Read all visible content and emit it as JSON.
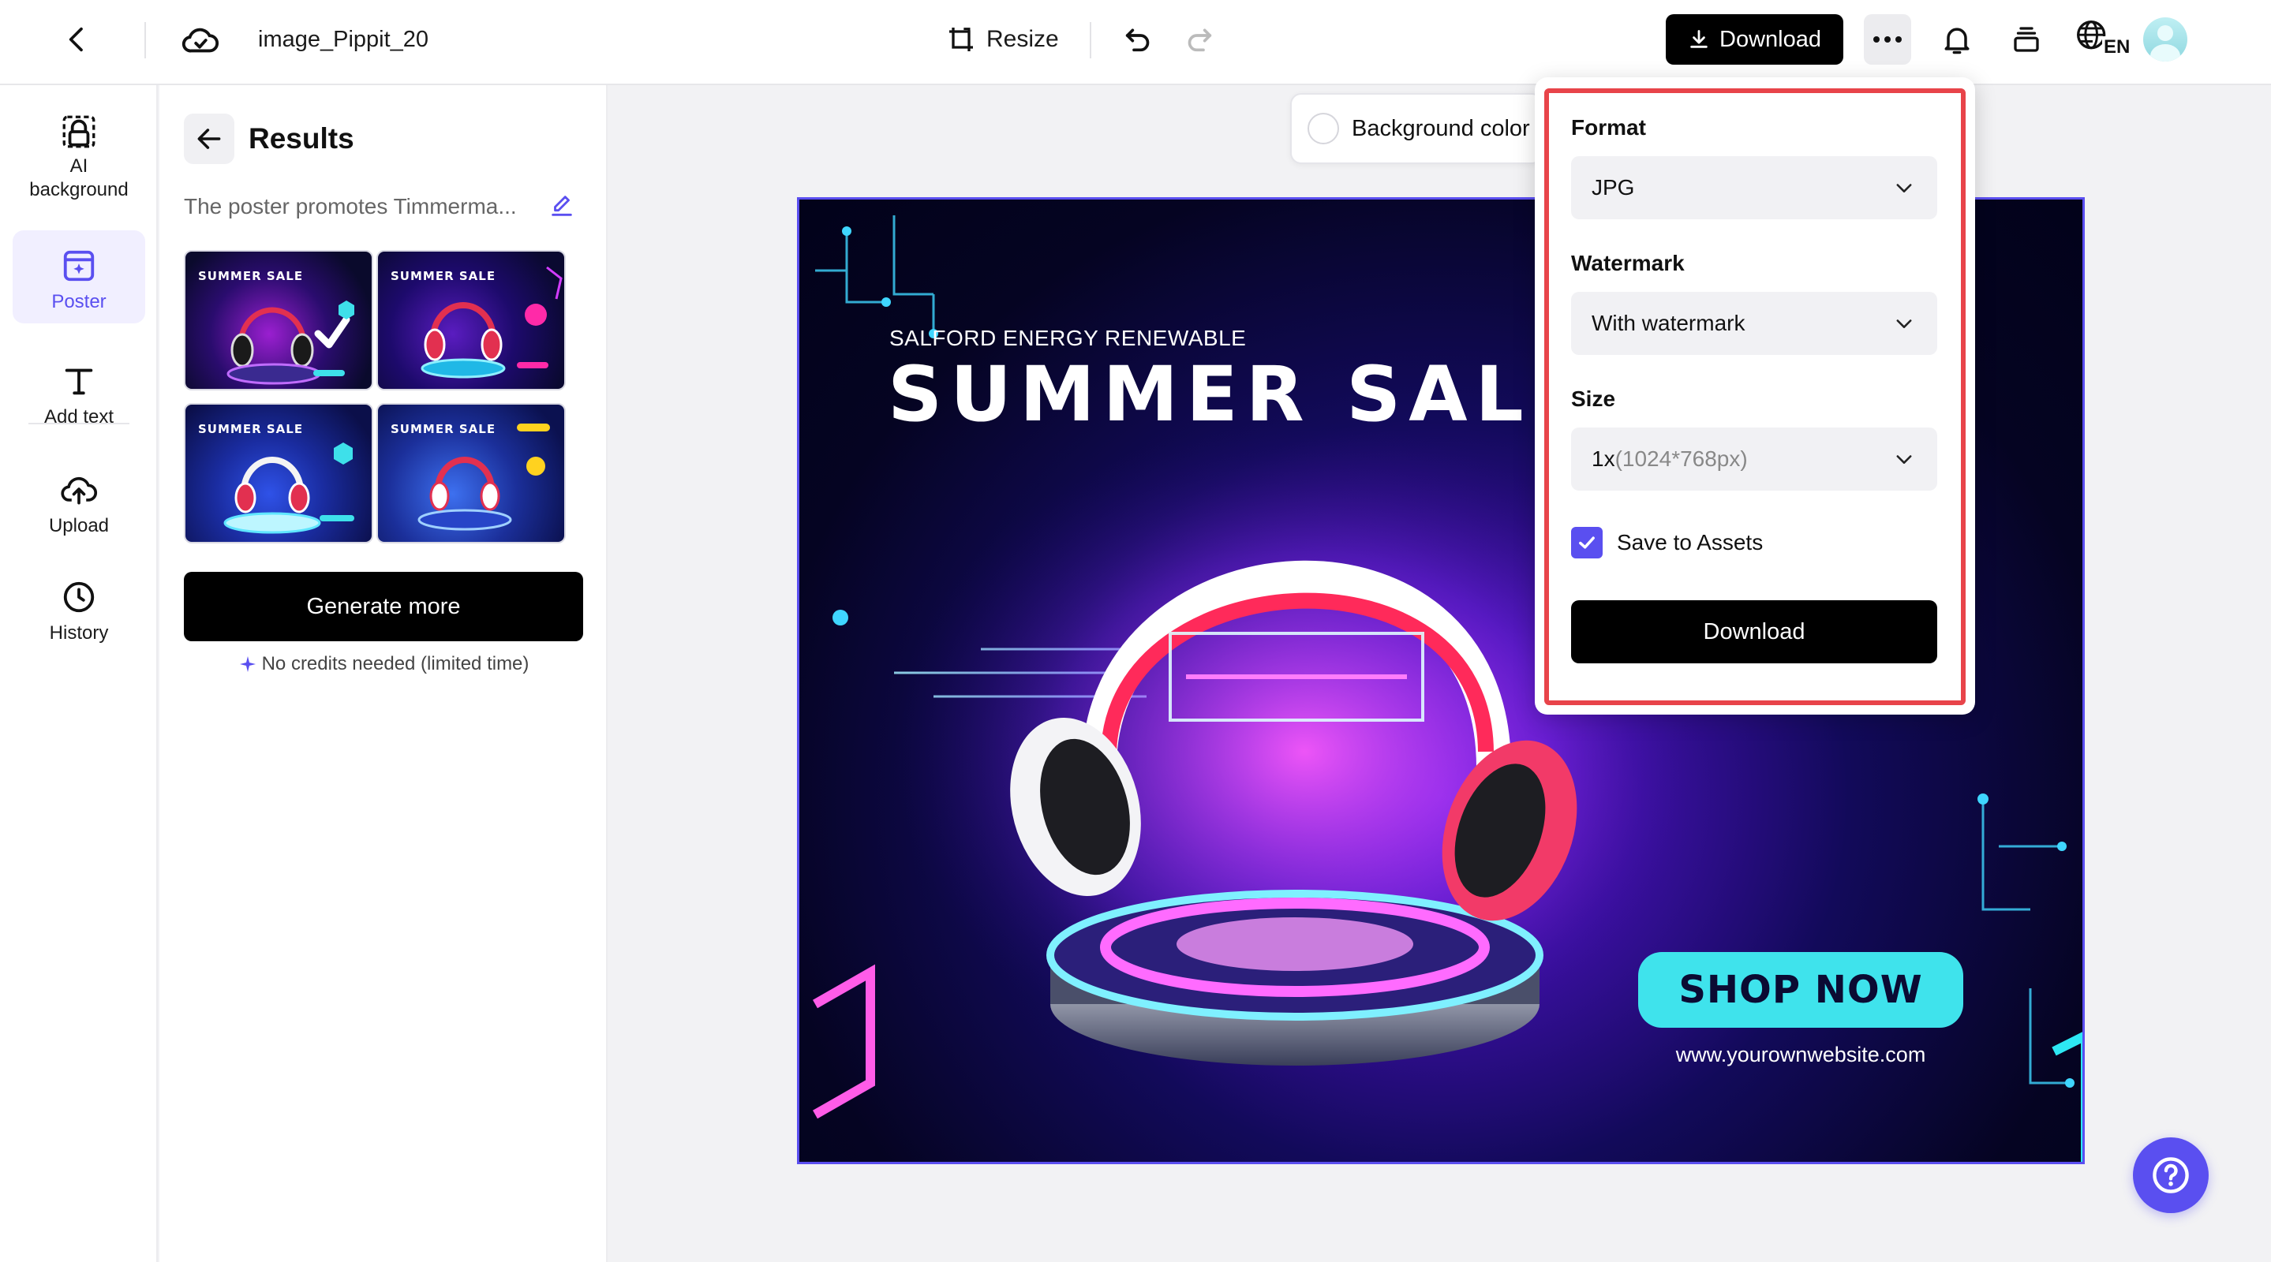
{
  "header": {
    "filename": "image_Pippit_20",
    "resize_label": "Resize",
    "download_label": "Download",
    "language_badge": "EN"
  },
  "sidebar": {
    "items": [
      {
        "label": "AI\nbackground",
        "icon": "ai-background-icon"
      },
      {
        "label": "Poster",
        "icon": "poster-icon"
      },
      {
        "label": "Add text",
        "icon": "text-icon"
      },
      {
        "label": "Upload",
        "icon": "upload-icon"
      },
      {
        "label": "History",
        "icon": "history-icon"
      }
    ],
    "active_item": "Poster"
  },
  "results_panel": {
    "title": "Results",
    "prompt": "The poster promotes Timmerma...",
    "thumbnails": [
      {
        "title": "SUMMER SALE"
      },
      {
        "title": "SUMMER SALE"
      },
      {
        "title": "SUMMER SALE"
      },
      {
        "title": "SUMMER SALE"
      }
    ],
    "generate_more_label": "Generate more",
    "credits_note": "No credits needed (limited time)"
  },
  "canvas": {
    "background_color_label": "Background color",
    "poster": {
      "subtitle": "SALFORD ENERGY RENEWABLE",
      "title": "SUMMER SALE",
      "cta": "SHOP NOW",
      "website": "www.yourownwebsite.com"
    }
  },
  "download_popover": {
    "format_label": "Format",
    "format_value": "JPG",
    "watermark_label": "Watermark",
    "watermark_value": "With watermark",
    "size_label": "Size",
    "size_value": "1x",
    "size_detail": "(1024*768px)",
    "save_to_assets_label": "Save to Assets",
    "save_to_assets_checked": true,
    "download_label": "Download"
  },
  "colors": {
    "accent": "#5a4ff0",
    "highlight": "#e8444a",
    "cta": "#3fe3ec"
  }
}
